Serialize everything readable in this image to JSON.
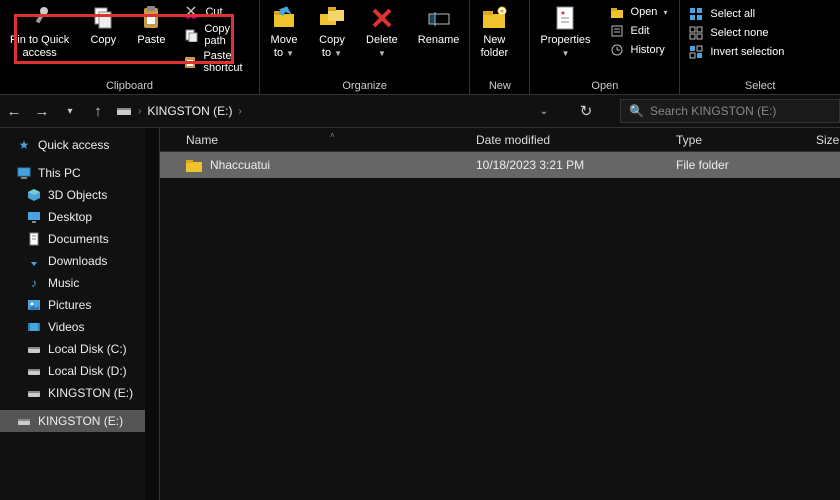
{
  "ribbon": {
    "clipboard": {
      "pin": "Pin to Quick\naccess",
      "copy": "Copy",
      "paste": "Paste",
      "cut": "Cut",
      "copy_path": "Copy path",
      "paste_shortcut": "Paste shortcut",
      "label": "Clipboard"
    },
    "organize": {
      "move_to": "Move\nto",
      "copy_to": "Copy\nto",
      "delete": "Delete",
      "rename": "Rename",
      "label": "Organize"
    },
    "new": {
      "new_folder": "New\nfolder",
      "label": "New"
    },
    "open": {
      "properties": "Properties",
      "open": "Open",
      "edit": "Edit",
      "history": "History",
      "label": "Open"
    },
    "select": {
      "select_all": "Select all",
      "select_none": "Select none",
      "invert": "Invert selection",
      "label": "Select"
    }
  },
  "address": {
    "drive": "KINGSTON (E:)",
    "search_placeholder": "Search KINGSTON (E:)"
  },
  "sidebar": {
    "quick_access": "Quick access",
    "this_pc": "This PC",
    "items": [
      "3D Objects",
      "Desktop",
      "Documents",
      "Downloads",
      "Music",
      "Pictures",
      "Videos",
      "Local Disk (C:)",
      "Local Disk (D:)",
      "KINGSTON (E:)"
    ],
    "overflow": "KINGSTON (E:)"
  },
  "columns": {
    "name": "Name",
    "date": "Date modified",
    "type": "Type",
    "size": "Size"
  },
  "files": [
    {
      "name": "Nhaccuatui",
      "date": "10/18/2023 3:21 PM",
      "type": "File folder"
    }
  ]
}
